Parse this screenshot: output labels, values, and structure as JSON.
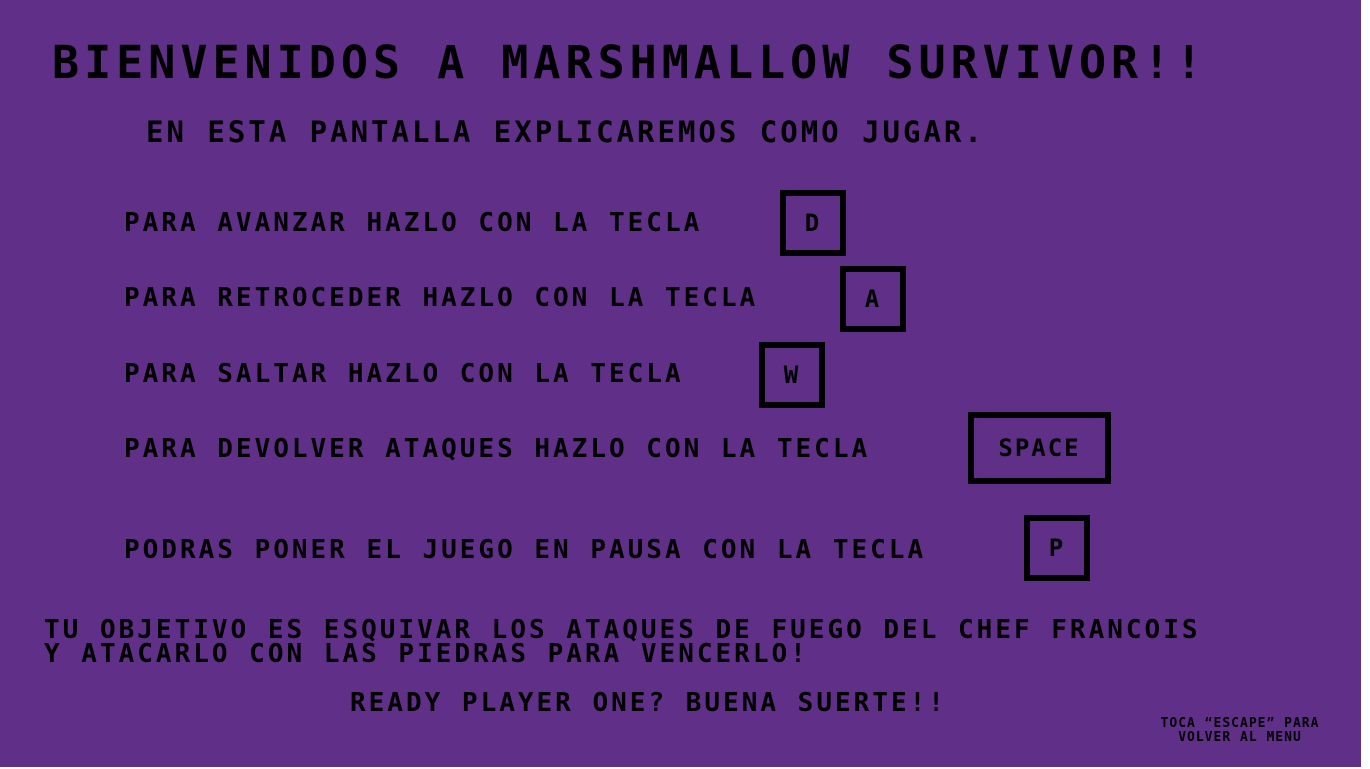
{
  "game": {
    "title": "BIENVENIDOS A MARSHMALLOW SURVIVOR!!",
    "subtitle": "EN ESTA PANTALLA EXPLICAREMOS COMO JUGAR."
  },
  "controls": [
    {
      "text": "PARA AVANZAR HAZLO CON LA TECLA",
      "key": "D"
    },
    {
      "text": "PARA RETROCEDER HAZLO CON LA TECLA",
      "key": "A"
    },
    {
      "text": "PARA SALTAR HAZLO CON LA TECLA",
      "key": "W"
    },
    {
      "text": "PARA DEVOLVER ATAQUES HAZLO CON LA TECLA",
      "key": "SPACE"
    },
    {
      "text": "PODRAS PONER EL JUEGO EN PAUSA CON LA TECLA",
      "key": "P"
    }
  ],
  "objective": {
    "line1": "TU OBJETIVO ES ESQUIVAR LOS ATAQUES DE FUEGO DEL CHEF FRANCOIS",
    "line2": "Y ATACARLO CON LAS PIEDRAS PARA VENCERLO!"
  },
  "ready": "READY PLAYER ONE? BUENA SUERTE!!",
  "escape_hint": {
    "line1": "TOCA “ESCAPE” PARA",
    "line2": "VOLVER AL MENU"
  },
  "colors": {
    "background": "#602f87",
    "text": "#000000"
  }
}
